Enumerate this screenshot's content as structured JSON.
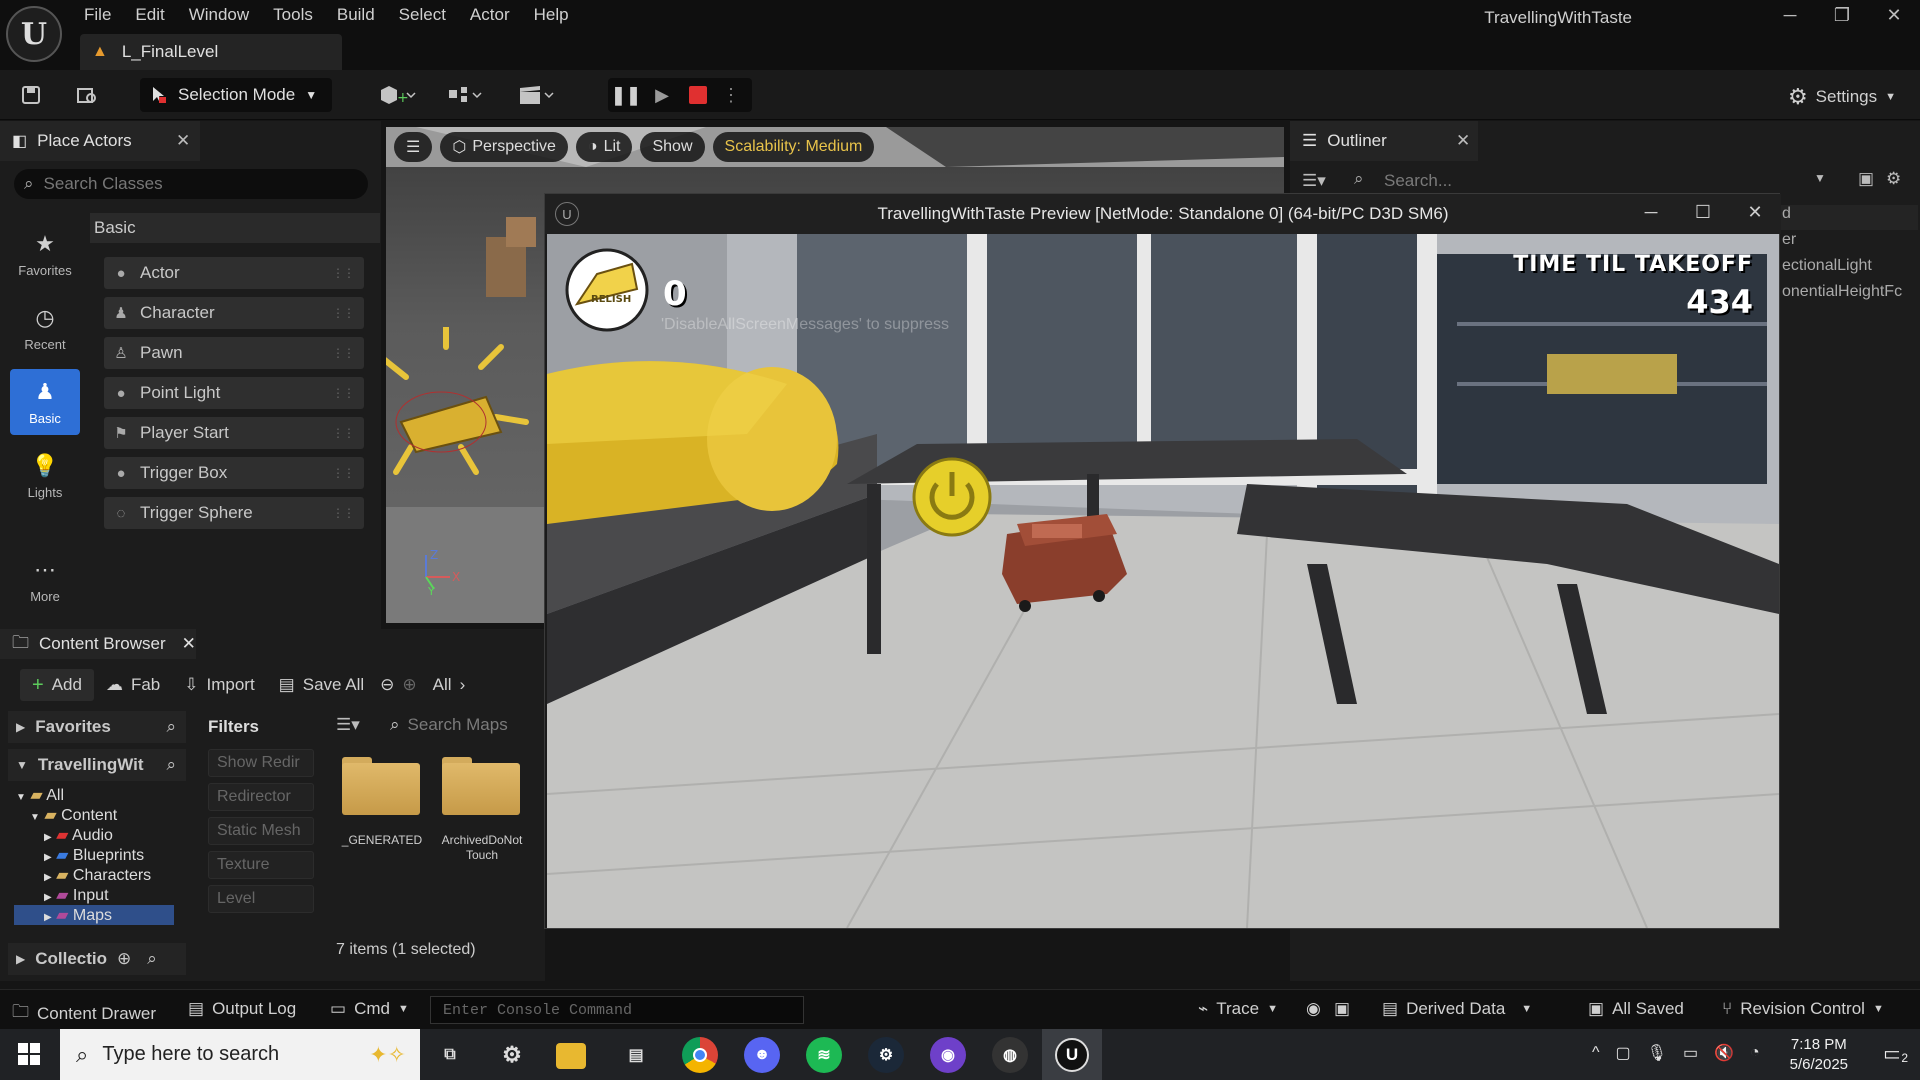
{
  "menu": [
    "File",
    "Edit",
    "Window",
    "Tools",
    "Build",
    "Select",
    "Actor",
    "Help"
  ],
  "map_tab": "L_FinalLevel",
  "app_title": "TravellingWithTaste",
  "toolbar": {
    "selection_mode": "Selection Mode",
    "settings": "Settings"
  },
  "place_actors": {
    "title": "Place Actors",
    "search_placeholder": "Search Classes",
    "categories": [
      {
        "label": "Favorites",
        "icon": "star-icon"
      },
      {
        "label": "Recent",
        "icon": "clock-icon"
      },
      {
        "label": "Basic",
        "icon": "basic-shapes-icon"
      },
      {
        "label": "Lights",
        "icon": "bulb-icon"
      },
      {
        "label": "More",
        "icon": "more-icon"
      }
    ],
    "section": "Basic",
    "items": [
      "Actor",
      "Character",
      "Pawn",
      "Point Light",
      "Player Start",
      "Trigger Box",
      "Trigger Sphere"
    ]
  },
  "viewport": {
    "perspective": "Perspective",
    "lit": "Lit",
    "show": "Show",
    "scalability": "Scalability: Medium"
  },
  "outliner": {
    "title": "Outliner",
    "search_placeholder": "Search...",
    "rows": [
      "d",
      "er",
      "ectionalLight",
      "onentialHeightFc"
    ]
  },
  "preview": {
    "title": "TravellingWithTaste Preview [NetMode: Standalone 0]  (64-bit/PC D3D SM6)",
    "hud_score": "0",
    "hud_message": "'DisableAllScreenMessages' to suppress",
    "ttl_label": "TIME TIL TAKEOFF",
    "ttl_value": "434",
    "badge_text": "RELISH"
  },
  "content_browser": {
    "title": "Content Browser",
    "add": "Add",
    "fab": "Fab",
    "import": "Import",
    "save_all": "Save All",
    "path": "All",
    "favorites": "Favorites",
    "project": "TravellingWit",
    "tree": [
      "All",
      "Content",
      "Audio",
      "Blueprints",
      "Characters",
      "Input",
      "Maps"
    ],
    "collections": "Collectio",
    "filters_title": "Filters",
    "filters": [
      "Show Redir",
      "Redirector",
      "Static Mesh",
      "Texture",
      "Level"
    ],
    "search_placeholder": "Search Maps",
    "folders": [
      "_GENERATED",
      "ArchivedDoNot Touch"
    ],
    "count": "7 items (1 selected)"
  },
  "status": {
    "content_drawer": "Content Drawer",
    "output_log": "Output Log",
    "cmd": "Cmd",
    "console_placeholder": "Enter Console Command",
    "trace": "Trace",
    "derived_data": "Derived Data",
    "all_saved": "All Saved",
    "revision_control": "Revision Control"
  },
  "taskbar": {
    "search_placeholder": "Type here to search",
    "time": "7:18 PM",
    "date": "5/6/2025",
    "notifications": "2"
  },
  "colors": {
    "accent": "#2e6fd6",
    "stop": "#e03030",
    "scalability": "#e8c34a",
    "cheese": "#e8c43a"
  }
}
